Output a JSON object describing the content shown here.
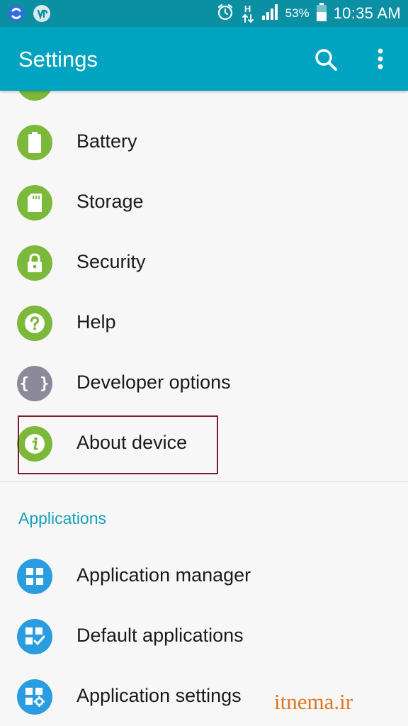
{
  "status_bar": {
    "time": "10:35 AM",
    "battery_percent": "53%",
    "network_type": "H",
    "icons": [
      "sync-app-icon",
      "notification-app-icon",
      "alarm-icon",
      "data-transfer-icon",
      "signal-icon",
      "battery-icon"
    ]
  },
  "app_bar": {
    "title": "Settings",
    "actions": [
      "search-icon",
      "more-options-icon"
    ]
  },
  "sections": [
    {
      "header": "",
      "items": [
        {
          "label": "Battery",
          "icon": "battery-icon",
          "color": "#7cb83a"
        },
        {
          "label": "Storage",
          "icon": "sd-card-icon",
          "color": "#7cb83a"
        },
        {
          "label": "Security",
          "icon": "lock-icon",
          "color": "#7cb83a"
        },
        {
          "label": "Help",
          "icon": "help-icon",
          "color": "#7cb83a"
        },
        {
          "label": "Developer options",
          "icon": "braces-icon",
          "color": "#8c8a9a"
        },
        {
          "label": "About device",
          "icon": "info-icon",
          "color": "#7cb83a",
          "highlighted": true
        }
      ]
    },
    {
      "header": "Applications",
      "items": [
        {
          "label": "Application manager",
          "icon": "app-grid-icon",
          "color": "#2a9de0"
        },
        {
          "label": "Default applications",
          "icon": "app-grid-check-icon",
          "color": "#2a9de0"
        },
        {
          "label": "Application settings",
          "icon": "app-grid-gear-icon",
          "color": "#2a9de0"
        }
      ]
    }
  ],
  "watermark": "itnema.ir",
  "colors": {
    "status_bar": "#0a8fa3",
    "app_bar": "#00a4c0",
    "accent": "#16a0b8",
    "highlight_border": "#7a1f2b",
    "watermark": "#e2751f"
  }
}
